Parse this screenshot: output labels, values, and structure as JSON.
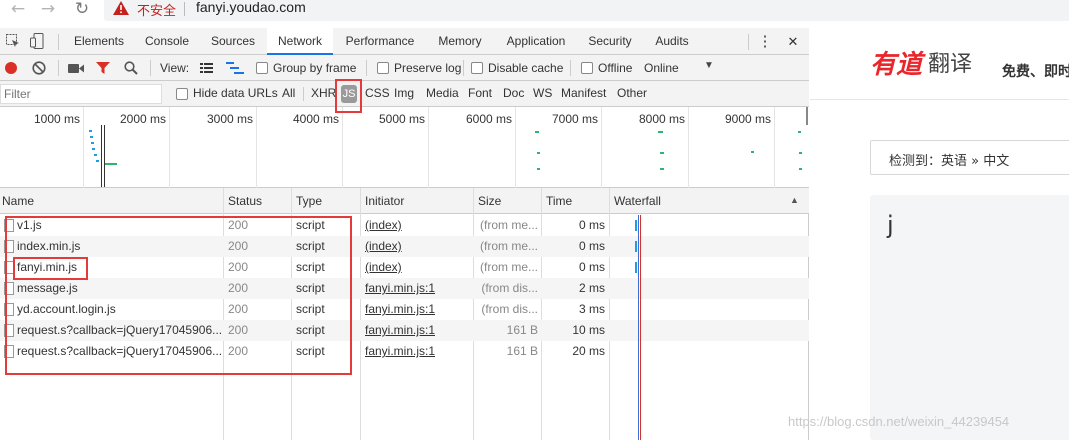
{
  "browser": {
    "back_icon": "arrow-left-icon",
    "forward_icon": "arrow-right-icon",
    "reload_icon": "reload-icon",
    "security_label": "不安全",
    "url": "fanyi.youdao.com"
  },
  "devtools": {
    "tabs": [
      "Elements",
      "Console",
      "Sources",
      "Network",
      "Performance",
      "Memory",
      "Application",
      "Security",
      "Audits"
    ],
    "active_tab": "Network",
    "menu_glyph": "⋮",
    "close_glyph": "✕",
    "toolbar": {
      "view_label": "View:",
      "group_by_frame": "Group by frame",
      "preserve_log": "Preserve log",
      "disable_cache": "Disable cache",
      "offline": "Offline",
      "throttle": "Online"
    },
    "filter": {
      "placeholder": "Filter",
      "hide_data_urls": "Hide data URLs",
      "types": [
        "All",
        "XHR",
        "JS",
        "CSS",
        "Img",
        "Media",
        "Font",
        "Doc",
        "WS",
        "Manifest",
        "Other"
      ],
      "selected_type": "JS"
    },
    "overview_ticks": [
      "1000 ms",
      "2000 ms",
      "3000 ms",
      "4000 ms",
      "5000 ms",
      "6000 ms",
      "7000 ms",
      "8000 ms",
      "9000 ms"
    ],
    "columns": [
      "Name",
      "Status",
      "Type",
      "Initiator",
      "Size",
      "Time",
      "Waterfall"
    ],
    "requests": [
      {
        "name": "v1.js",
        "status": "200",
        "type": "script",
        "initiator": "(index)",
        "size": "(from me...",
        "time": "0 ms"
      },
      {
        "name": "index.min.js",
        "status": "200",
        "type": "script",
        "initiator": "(index)",
        "size": "(from me...",
        "time": "0 ms"
      },
      {
        "name": "fanyi.min.js",
        "status": "200",
        "type": "script",
        "initiator": "(index)",
        "size": "(from me...",
        "time": "0 ms"
      },
      {
        "name": "message.js",
        "status": "200",
        "type": "script",
        "initiator": "fanyi.min.js:1",
        "size": "(from dis...",
        "time": "2 ms"
      },
      {
        "name": "yd.account.login.js",
        "status": "200",
        "type": "script",
        "initiator": "fanyi.min.js:1",
        "size": "(from dis...",
        "time": "3 ms"
      },
      {
        "name": "request.s?callback=jQuery17045906...",
        "status": "200",
        "type": "script",
        "initiator": "fanyi.min.js:1",
        "size": "161 B",
        "time": "10 ms"
      },
      {
        "name": "request.s?callback=jQuery17045906...",
        "status": "200",
        "type": "script",
        "initiator": "fanyi.min.js:1",
        "size": "161 B",
        "time": "20 ms"
      }
    ]
  },
  "page": {
    "logo_red": "有道",
    "logo_dark": "翻译",
    "tagline": "免费、即时",
    "language_detect": "检测到：英语  »  中文",
    "input_text": "j",
    "watermark": "https://blog.csdn.net/weixin_44239454"
  },
  "colors": {
    "accent": "#1a73e8",
    "record_red": "#d93025",
    "annotation_red": "#e33b3b",
    "logo_red": "#e8262c"
  }
}
